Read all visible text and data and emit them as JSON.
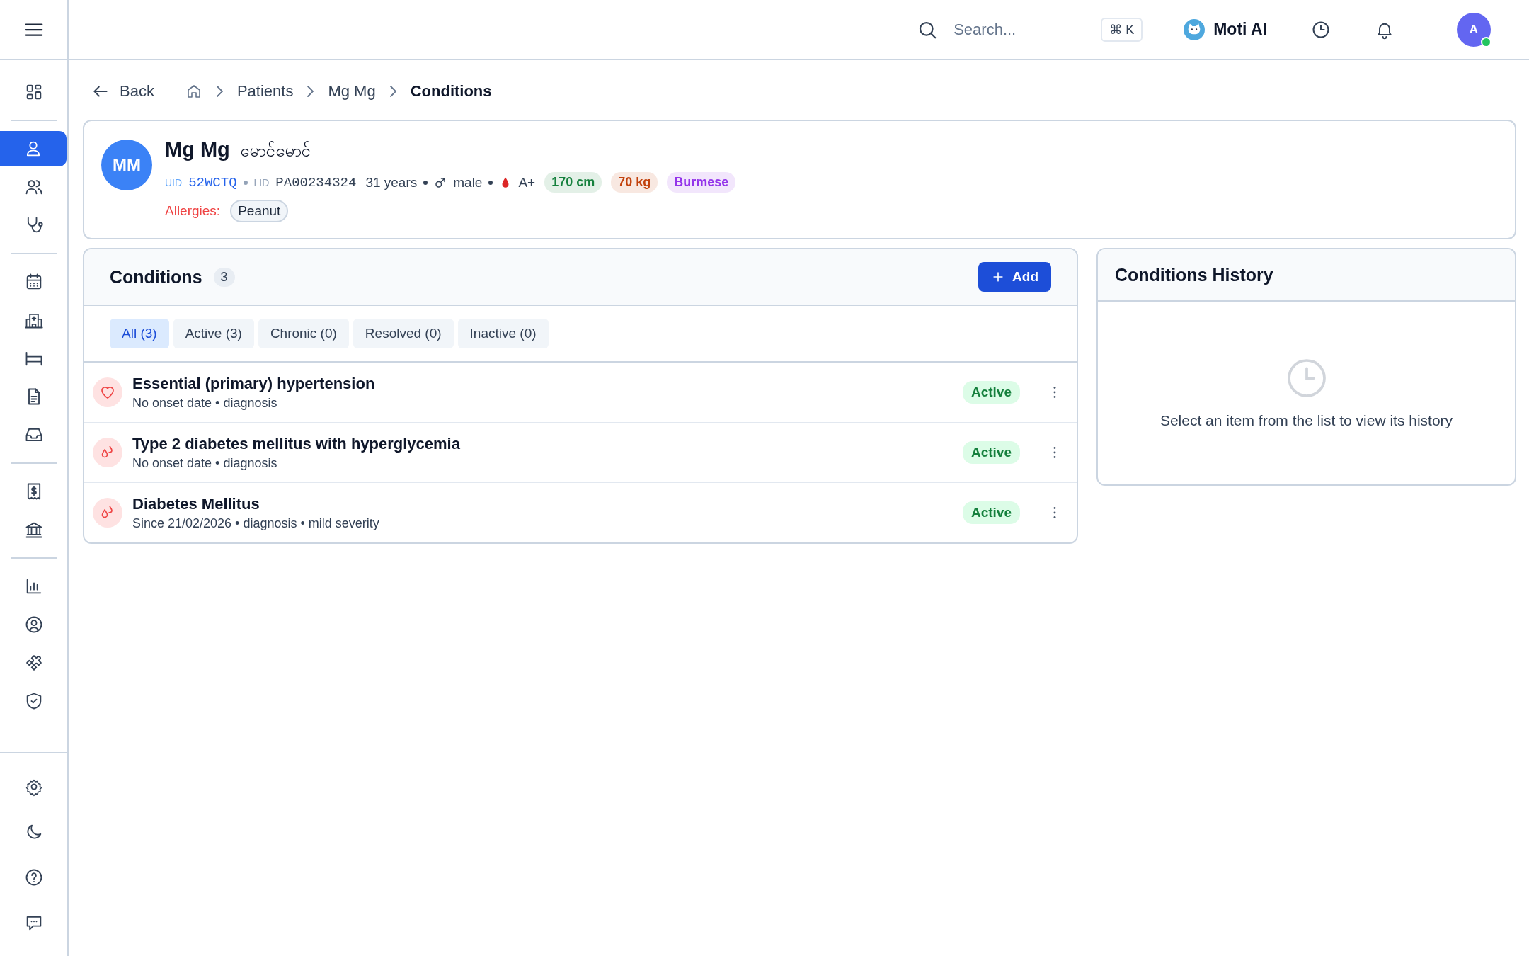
{
  "sidebar": {
    "groups": [
      {
        "items": [
          {
            "kind": "grid",
            "selected": false
          }
        ]
      },
      {
        "items": [
          {
            "kind": "user",
            "selected": true
          },
          {
            "kind": "users",
            "selected": false
          },
          {
            "kind": "stethoscope",
            "selected": false
          }
        ]
      },
      {
        "items": [
          {
            "kind": "calendar",
            "selected": false
          },
          {
            "kind": "hospital",
            "selected": false
          },
          {
            "kind": "bed",
            "selected": false
          },
          {
            "kind": "document",
            "selected": false
          },
          {
            "kind": "inbox",
            "selected": false
          }
        ]
      },
      {
        "items": [
          {
            "kind": "receipt",
            "selected": false
          },
          {
            "kind": "bank",
            "selected": false
          }
        ]
      },
      {
        "items": [
          {
            "kind": "chart",
            "selected": false
          },
          {
            "kind": "user-circle",
            "selected": false
          },
          {
            "kind": "puzzle",
            "selected": false
          },
          {
            "kind": "shield",
            "selected": false
          }
        ]
      }
    ],
    "bottom_items": [
      {
        "kind": "settings",
        "selected": false
      },
      {
        "kind": "moon",
        "selected": false
      },
      {
        "kind": "help",
        "selected": false
      },
      {
        "kind": "chat",
        "selected": false
      }
    ]
  },
  "top_bar": {
    "search": {
      "placeholder": "Search..."
    },
    "shortcut": "⌘ K",
    "assistant": "Moti AI",
    "avatar": "A",
    "online": true
  },
  "breadcrumb": {
    "back": "Back",
    "items": [
      "Patients",
      "Mg Mg",
      "Conditions"
    ]
  },
  "patient": {
    "initials": "MM",
    "name": "Mg Mg",
    "local_name": "မောင်မောင်",
    "uid_label": "UID",
    "uid": "52WCTQ",
    "lid_label": "LID",
    "lid": "PA00234324",
    "age": "31 years",
    "gender": "male",
    "blood_type": "A+",
    "tags": [
      {
        "text": "170 cm",
        "color": "#15803d"
      },
      {
        "text": "70 kg",
        "color": "#c2410c"
      },
      {
        "text": "Burmese",
        "color": "#9333ea"
      }
    ],
    "allergies_label": "Allergies:",
    "allergies": [
      "Peanut"
    ]
  },
  "conditions": {
    "title": "Conditions",
    "count": "3",
    "add_button": "Add",
    "filters": [
      {
        "label": "All (3)",
        "selected": true
      },
      {
        "label": "Active (3)",
        "selected": false
      },
      {
        "label": "Chronic (0)",
        "selected": false
      },
      {
        "label": "Resolved (0)",
        "selected": false
      },
      {
        "label": "Inactive (0)",
        "selected": false
      }
    ],
    "items": [
      {
        "kind": "heart",
        "name": "Essential (primary) hypertension",
        "detail": "No onset date • diagnosis",
        "status": "Active"
      },
      {
        "kind": "drops",
        "name": "Type 2 diabetes mellitus with hyperglycemia",
        "detail": "No onset date • diagnosis",
        "status": "Active"
      },
      {
        "kind": "drops",
        "name": "Diabetes Mellitus",
        "detail": "Since 21/02/2026 • diagnosis • mild severity",
        "status": "Active"
      }
    ]
  },
  "history": {
    "title": "Conditions History",
    "empty_message": "Select an item from the list to view its history"
  }
}
